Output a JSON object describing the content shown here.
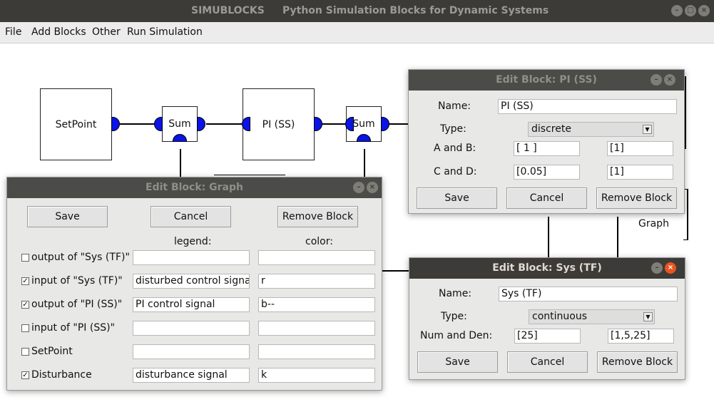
{
  "window": {
    "app_name": "SIMUBLOCKS",
    "subtitle": "Python Simulation Blocks for Dynamic Systems",
    "minimize": "–",
    "maximize": "□",
    "close": "×"
  },
  "menu": [
    "File",
    "Add Blocks",
    "Other",
    "Run Simulation"
  ],
  "blocks": {
    "setpoint": "SetPoint",
    "sum1": "Sum",
    "pi": "PI (SS)",
    "sum2": "Sum",
    "graph_label": "Graph"
  },
  "graph_dialog": {
    "title": "Edit Block: Graph",
    "save": "Save",
    "cancel": "Cancel",
    "remove": "Remove Block",
    "legend_header": "legend:",
    "color_header": "color:",
    "rows": [
      {
        "label": "output of \"Sys (TF)\"",
        "checked": false,
        "legend": "",
        "color": ""
      },
      {
        "label": "input of \"Sys (TF)\"",
        "checked": true,
        "legend": "disturbed control signal",
        "color": "r"
      },
      {
        "label": "output of \"PI (SS)\"",
        "checked": true,
        "legend": "PI control signal",
        "color": "b--"
      },
      {
        "label": "input of \"PI (SS)\"",
        "checked": false,
        "legend": "",
        "color": ""
      },
      {
        "label": "SetPoint",
        "checked": false,
        "legend": "",
        "color": ""
      },
      {
        "label": "Disturbance",
        "checked": true,
        "legend": "disturbance signal",
        "color": "k"
      }
    ]
  },
  "pi_dialog": {
    "title": "Edit Block: PI (SS)",
    "name_label": "Name:",
    "name_value": "PI (SS)",
    "type_label": "Type:",
    "type_value": "discrete",
    "ab_label": "A and B:",
    "a_value": "[ 1 ]",
    "b_value": "[1]",
    "cd_label": "C and D:",
    "c_value": "[0.05]",
    "d_value": "[1]",
    "save": "Save",
    "cancel": "Cancel",
    "remove": "Remove Block"
  },
  "tf_dialog": {
    "title": "Edit Block: Sys (TF)",
    "name_label": "Name:",
    "name_value": "Sys (TF)",
    "type_label": "Type:",
    "type_value": "continuous",
    "numden_label": "Num and Den:",
    "num_value": "[25]",
    "den_value": "[1,5,25]",
    "save": "Save",
    "cancel": "Cancel",
    "remove": "Remove Block"
  }
}
